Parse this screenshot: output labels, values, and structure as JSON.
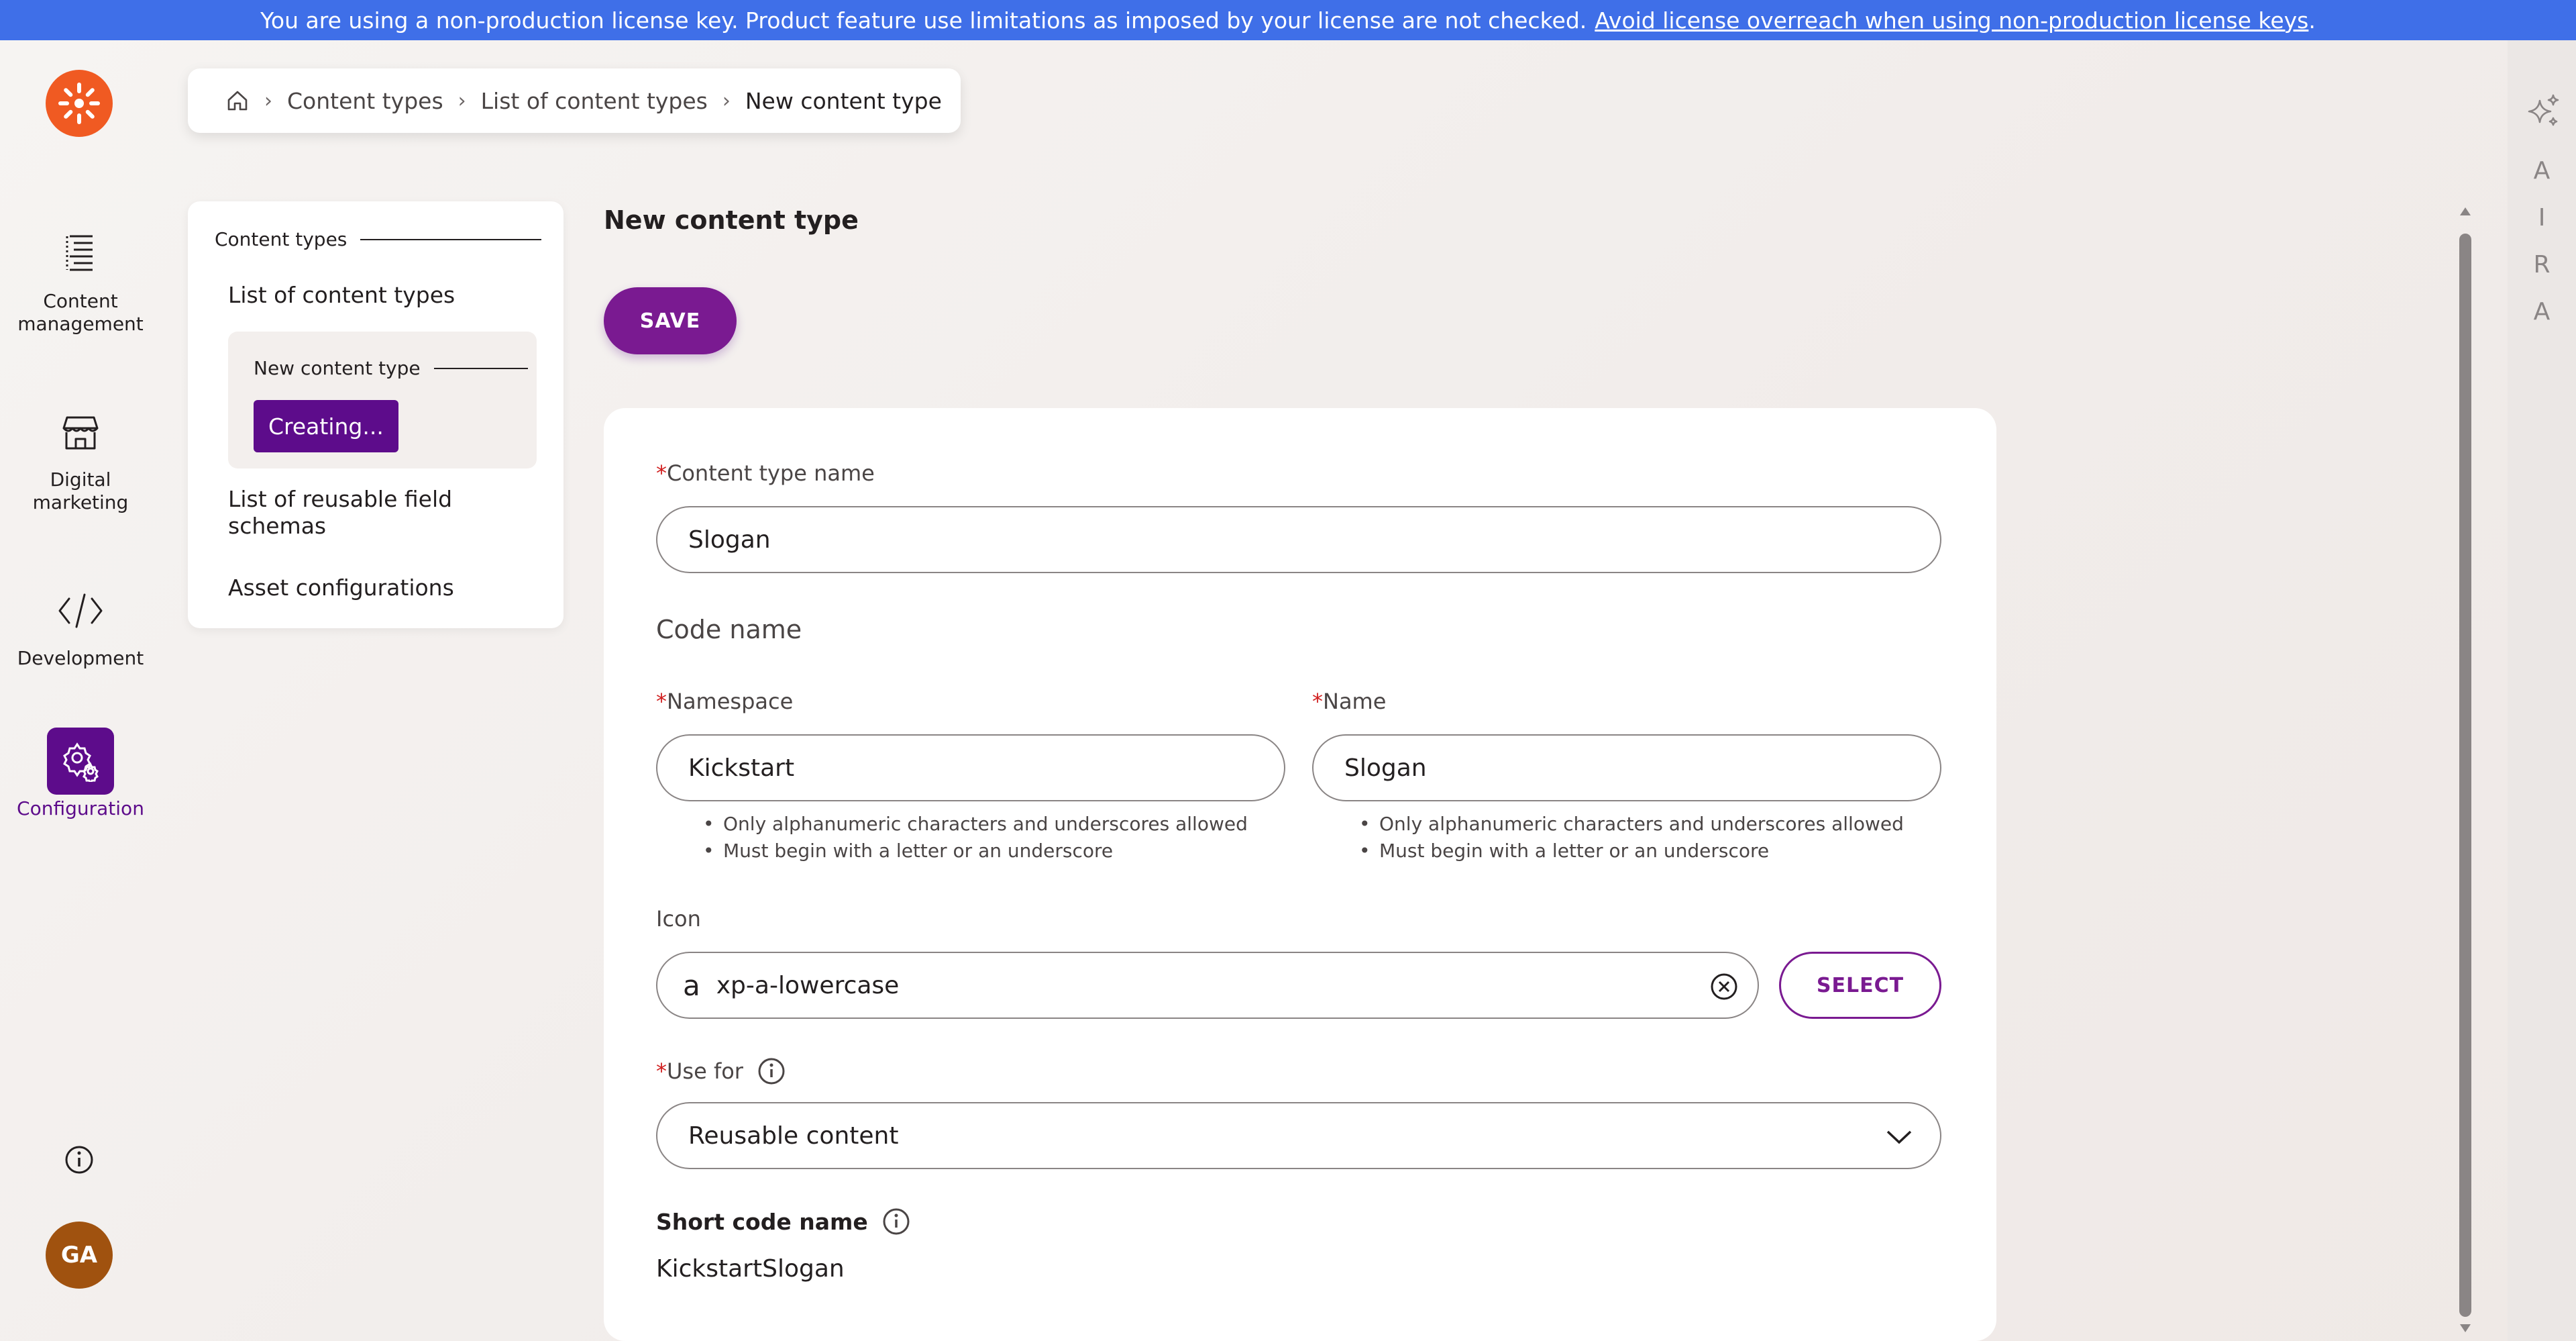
{
  "license_banner": {
    "text": "You are using a non-production license key. Product feature use limitations as imposed by your license are not checked.",
    "link": "Avoid license overreach when using non-production license keys",
    "suffix": "."
  },
  "rail": {
    "items": [
      {
        "label_line1": "Content",
        "label_line2": "management"
      },
      {
        "label_line1": "Digital",
        "label_line2": "marketing"
      },
      {
        "label_line1": "Development"
      },
      {
        "label_line1": "Configuration"
      }
    ],
    "avatar_initials": "GA"
  },
  "breadcrumb": {
    "items": [
      "Content types",
      "List of content types",
      "New content type"
    ]
  },
  "subnav": {
    "group_title": "Content types",
    "items": [
      "List of content types",
      "List of reusable field schemas",
      "Asset configurations"
    ],
    "sub_group_title": "New content type",
    "sub_active": "Creating..."
  },
  "main": {
    "title": "New content type",
    "save_label": "SAVE"
  },
  "form": {
    "content_type_name_label": "Content type name",
    "content_type_name_value": "Slogan",
    "code_name_heading": "Code name",
    "namespace_label": "Namespace",
    "namespace_value": "Kickstart",
    "name_label": "Name",
    "name_value": "Slogan",
    "hints": [
      "Only alphanumeric characters and underscores allowed",
      "Must begin with a letter or an underscore"
    ],
    "icon_label": "Icon",
    "icon_value": "xp-a-lowercase",
    "select_label": "SELECT",
    "use_for_label": "Use for",
    "use_for_value": "Reusable content",
    "short_code_name_label": "Short code name",
    "short_code_name_value": "KickstartSlogan",
    "required_mark": "*"
  },
  "aira": {
    "letters": [
      "A",
      "I",
      "R",
      "A"
    ]
  },
  "colors": {
    "banner": "#3f6fe8",
    "primary": "#7a1a91",
    "active_nav": "#5d0c8b",
    "logo": "#f05a22",
    "avatar": "#a0520f",
    "required": "#d11f1f"
  },
  "icons": {
    "home": "home-icon",
    "content_management": "content-management-icon",
    "digital_marketing": "storefront-icon",
    "development": "code-icon",
    "configuration": "gear-icon",
    "info": "info-icon",
    "sparkle": "sparkle-icon",
    "clear": "clear-circle-icon",
    "chevron": "chevron-down-icon"
  }
}
